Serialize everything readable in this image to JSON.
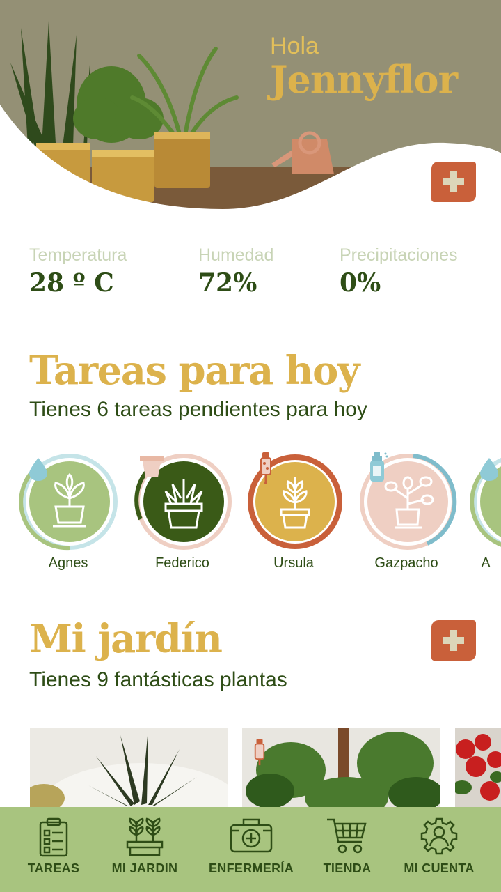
{
  "header": {
    "greeting": "Hola",
    "user_name": "Jennyflor"
  },
  "weather": [
    {
      "label": "Temperatura",
      "value": "28 º C"
    },
    {
      "label": "Humedad",
      "value": "72%"
    },
    {
      "label": "Precipitaciones",
      "value": "0%"
    }
  ],
  "tasks_section": {
    "title": "Tareas para hoy",
    "subtitle": "Tienes 6 tareas pendientes para hoy",
    "plants": [
      {
        "name": "Agnes",
        "task_icon": "water-drop-icon",
        "fill": "#a8c47f",
        "ring": "#c5e4e8"
      },
      {
        "name": "Federico",
        "task_icon": "flower-pot-icon",
        "fill": "#3a5a17",
        "ring": "#efcfc3"
      },
      {
        "name": "Ursula",
        "task_icon": "dropper-icon",
        "fill": "#dcb24c",
        "ring": "#c9603a"
      },
      {
        "name": "Gazpacho",
        "task_icon": "spray-bottle-icon",
        "fill": "#efcfc3",
        "ring": "#7fbccb"
      },
      {
        "name": "A",
        "task_icon": "water-drop-icon",
        "fill": "#a8c47f",
        "ring": "#c5e4e8"
      }
    ]
  },
  "garden_section": {
    "title": "Mi jardín",
    "subtitle": "Tienes 9 fantásticas plantas"
  },
  "nav": [
    {
      "label": "TAREAS",
      "icon": "clipboard-checklist-icon"
    },
    {
      "label": "MI JARDIN",
      "icon": "planter-icon"
    },
    {
      "label": "ENFERMERÍA",
      "icon": "first-aid-kit-icon"
    },
    {
      "label": "TIENDA",
      "icon": "shopping-cart-icon"
    },
    {
      "label": "MI CUENTA",
      "icon": "user-gear-icon"
    }
  ],
  "colors": {
    "accent_gold": "#dcb24c",
    "dark_green": "#2e4d16",
    "nav_green": "#a8c47f",
    "add_button": "#c9603a"
  }
}
